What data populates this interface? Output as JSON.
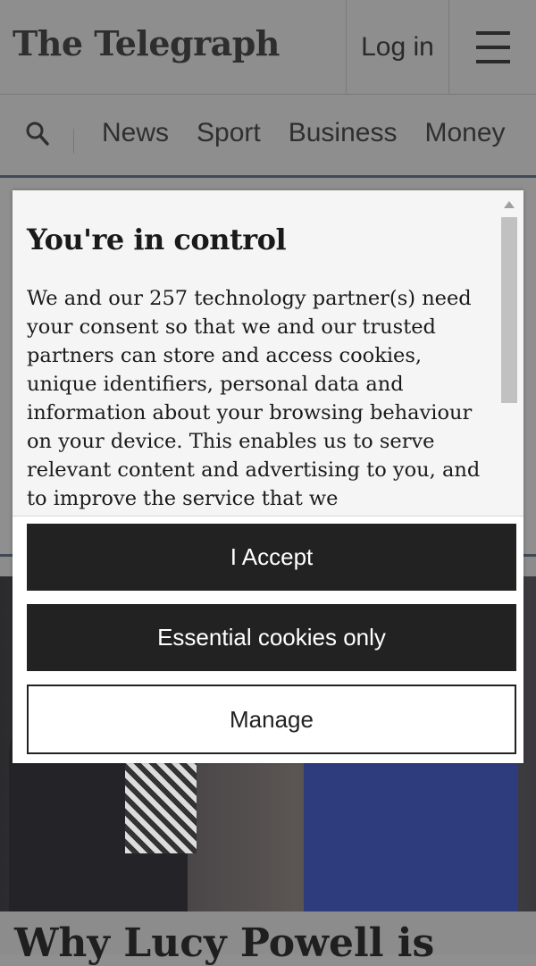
{
  "header": {
    "logo": "The Telegraph",
    "login_label": "Log in",
    "menu_icon": "hamburger-icon"
  },
  "nav": {
    "search_icon": "search-icon",
    "items": [
      "News",
      "Sport",
      "Business",
      "Money"
    ]
  },
  "article": {
    "headline": "Why Lucy Powell is"
  },
  "consent": {
    "title": "You're in control",
    "body": "We and our 257 technology partner(s) need your consent so that we and our trusted partners can store and access cookies, unique identifiers, personal data and information about your browsing behaviour on your device. This enables us to serve relevant content and advertising to you, and to improve the service that we",
    "accept_label": "I Accept",
    "essential_label": "Essential cookies only",
    "manage_label": "Manage"
  }
}
